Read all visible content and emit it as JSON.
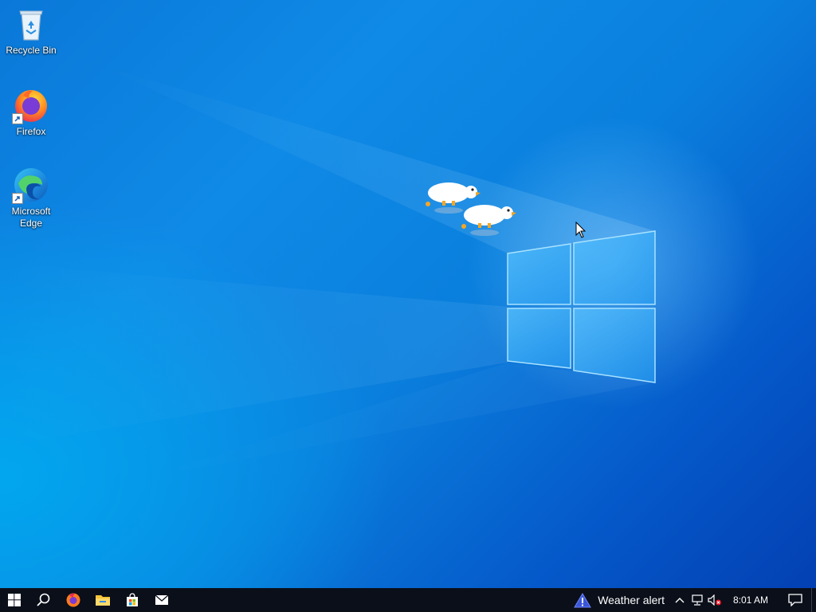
{
  "desktop": {
    "icons": [
      {
        "label": "Recycle Bin",
        "icon": "recycle-bin-icon"
      },
      {
        "label": "Firefox",
        "icon": "firefox-icon"
      },
      {
        "label": "Microsoft Edge",
        "icon": "edge-icon"
      }
    ],
    "wallpaper": "windows-10-light-hero",
    "overlay_sprites": [
      "goose-sprite",
      "goose-sprite"
    ]
  },
  "taskbar": {
    "pinned": [
      {
        "name": "start-button",
        "icon": "windows-logo-icon"
      },
      {
        "name": "search-button",
        "icon": "search-icon"
      },
      {
        "name": "firefox-taskbar",
        "icon": "firefox-icon"
      },
      {
        "name": "file-explorer-taskbar",
        "icon": "folder-icon"
      },
      {
        "name": "store-taskbar",
        "icon": "store-bag-icon"
      },
      {
        "name": "mail-taskbar",
        "icon": "mail-icon"
      }
    ],
    "weather_label": "Weather alert",
    "clock": "8:01 AM",
    "tray_icons": [
      "chevron-up-icon",
      "network-icon",
      "volume-muted-icon"
    ]
  },
  "colors": {
    "taskbar_bg": "#0a0f1a",
    "accent": "#0a78d8"
  }
}
